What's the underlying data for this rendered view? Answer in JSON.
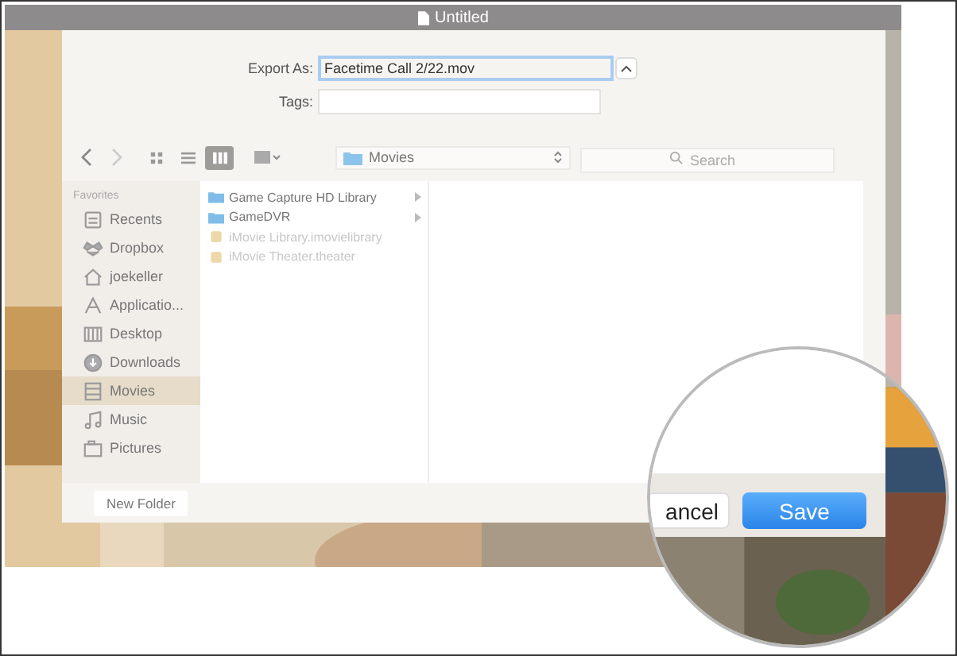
{
  "window": {
    "title": "Untitled"
  },
  "export": {
    "export_as_label": "Export As:",
    "filename": "Facetime Call 2/22.mov",
    "tags_label": "Tags:"
  },
  "toolbar": {
    "view_modes": [
      {
        "kind": "icon",
        "selected": false
      },
      {
        "kind": "list",
        "selected": false
      },
      {
        "kind": "column",
        "selected": true
      }
    ],
    "location": "Movies",
    "search_placeholder": "Search"
  },
  "sidebar": {
    "heading": "Favorites",
    "items": [
      {
        "label": "Recents",
        "kind": "recents",
        "selected": false
      },
      {
        "label": "Dropbox",
        "kind": "dropbox",
        "selected": false
      },
      {
        "label": "joekeller",
        "kind": "home",
        "selected": false
      },
      {
        "label": "Applicatio...",
        "kind": "apps",
        "selected": false
      },
      {
        "label": "Desktop",
        "kind": "desktop",
        "selected": false
      },
      {
        "label": "Downloads",
        "kind": "downloads",
        "selected": false
      },
      {
        "label": "Movies",
        "kind": "movies",
        "selected": true
      },
      {
        "label": "Music",
        "kind": "music",
        "selected": false
      },
      {
        "label": "Pictures",
        "kind": "pictures",
        "selected": false
      }
    ]
  },
  "files": [
    {
      "name": "Game Capture HD Library",
      "kind": "folder",
      "disabled": false
    },
    {
      "name": "GameDVR",
      "kind": "folder",
      "disabled": false
    },
    {
      "name": "iMovie Library.imovielibrary",
      "kind": "package",
      "disabled": true
    },
    {
      "name": "iMovie Theater.theater",
      "kind": "package",
      "disabled": true
    }
  ],
  "new_folder_button": "New Folder",
  "magnifier": {
    "buttons": [
      {
        "label": "ancel",
        "kind": "cancel"
      },
      {
        "label": "Save",
        "kind": "default"
      }
    ]
  }
}
